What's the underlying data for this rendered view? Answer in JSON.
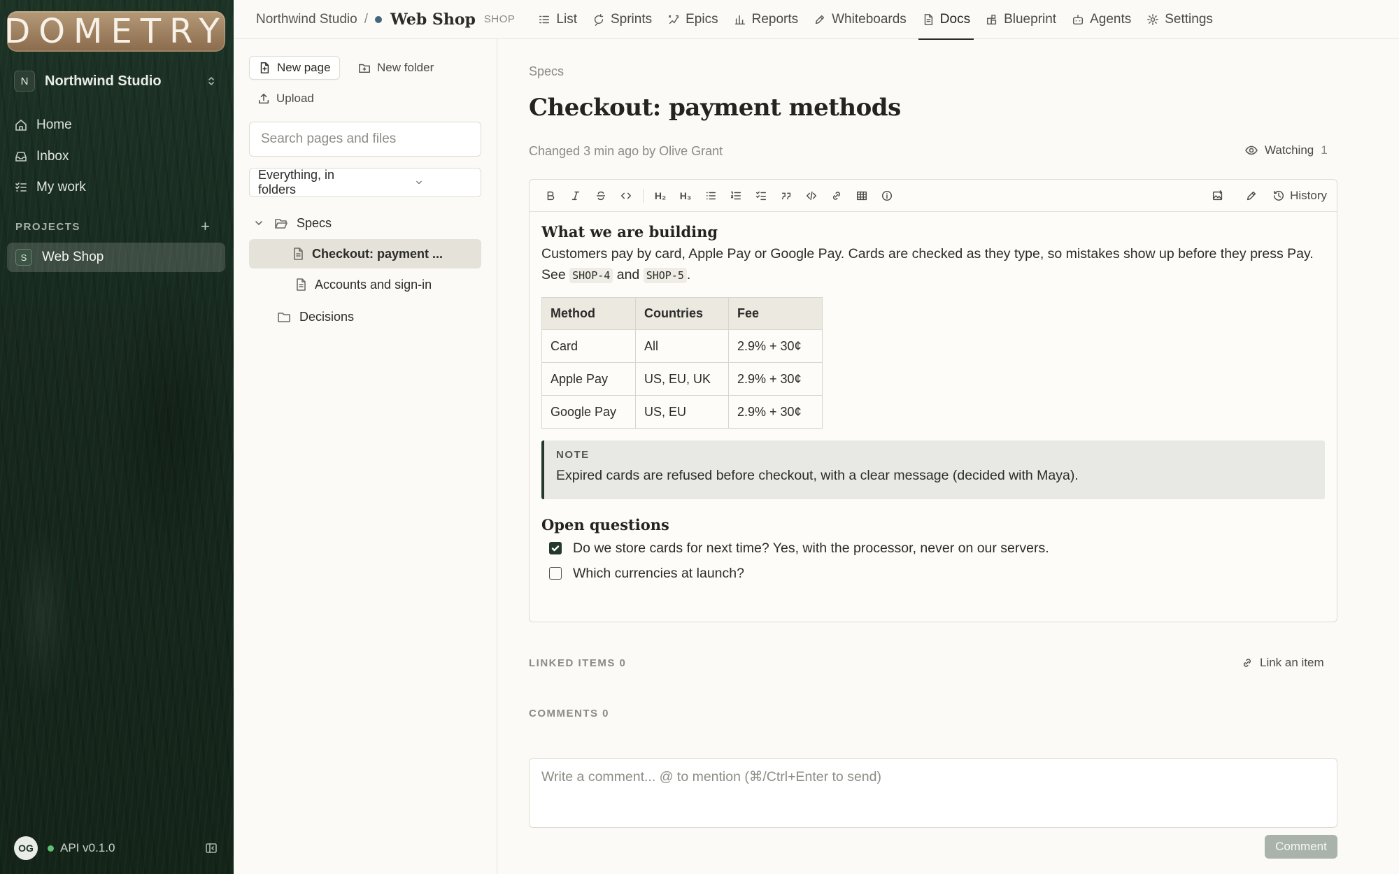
{
  "app": {
    "logo_text": "DOMETRY"
  },
  "sidebar": {
    "workspace": {
      "initial": "N",
      "name": "Northwind Studio"
    },
    "nav": [
      {
        "label": "Home",
        "icon": "home-icon"
      },
      {
        "label": "Inbox",
        "icon": "inbox-icon"
      },
      {
        "label": "My work",
        "icon": "checklist-icon"
      }
    ],
    "projects_label": "PROJECTS",
    "add_project": "+",
    "projects": [
      {
        "initial": "S",
        "name": "Web Shop"
      }
    ],
    "footer": {
      "avatar": "OG",
      "api_version": "API v0.1.0",
      "status_color": "#5fbf75"
    }
  },
  "topbar": {
    "org": "Northwind Studio",
    "separator": "/",
    "project": "Web Shop",
    "project_key": "SHOP",
    "tabs": [
      {
        "label": "List",
        "icon": "list-icon"
      },
      {
        "label": "Sprints",
        "icon": "sprint-icon"
      },
      {
        "label": "Epics",
        "icon": "epic-icon"
      },
      {
        "label": "Reports",
        "icon": "bar-chart-icon"
      },
      {
        "label": "Whiteboards",
        "icon": "pen-icon"
      },
      {
        "label": "Docs",
        "icon": "doc-icon",
        "active": true
      },
      {
        "label": "Blueprint",
        "icon": "blueprint-icon"
      },
      {
        "label": "Agents",
        "icon": "bot-icon"
      },
      {
        "label": "Settings",
        "icon": "gear-icon"
      }
    ]
  },
  "pages_panel": {
    "new_page": "New page",
    "new_folder": "New folder",
    "upload": "Upload",
    "search_placeholder": "Search pages and files",
    "filter_value": "Everything, in folders",
    "tree": {
      "folder_specs": "Specs",
      "page_checkout": "Checkout: payment ...",
      "page_accounts": "Accounts and sign-in",
      "folder_decisions": "Decisions"
    }
  },
  "doc": {
    "breadcrumb": "Specs",
    "title": "Checkout: payment methods",
    "meta": "Changed 3 min ago by Olive Grant",
    "watching_label": "Watching",
    "watching_count": "1",
    "toolbar": {
      "h2": "H₂",
      "h3": "H₃",
      "history": "History"
    },
    "heading1": "What we are building",
    "para_text": "Customers pay by card, Apple Pay or Google Pay. Cards are checked as they type, so mistakes show up before they press Pay. See ",
    "code1": "SHOP-4",
    "para_and": " and ",
    "code2": "SHOP-5",
    "para_end": ".",
    "table": {
      "headers": [
        "Method",
        "Countries",
        "Fee"
      ],
      "rows": [
        [
          "Card",
          "All",
          "2.9% + 30¢"
        ],
        [
          "Apple Pay",
          "US, EU, UK",
          "2.9% + 30¢"
        ],
        [
          "Google Pay",
          "US, EU",
          "2.9% + 30¢"
        ]
      ]
    },
    "note_label": "NOTE",
    "note_text": "Expired cards are refused before checkout, with a clear message (decided with Maya).",
    "heading2": "Open questions",
    "todos": [
      {
        "text": "Do we store cards for next time? Yes, with the processor, never on our servers.",
        "checked": true
      },
      {
        "text": "Which currencies at launch?",
        "checked": false
      }
    ]
  },
  "linked": {
    "label": "LINKED ITEMS 0",
    "link_action": "Link an item"
  },
  "comments": {
    "label": "COMMENTS 0",
    "placeholder": "Write a comment... @ to mention (⌘/Ctrl+Enter to send)",
    "button": "Comment"
  }
}
